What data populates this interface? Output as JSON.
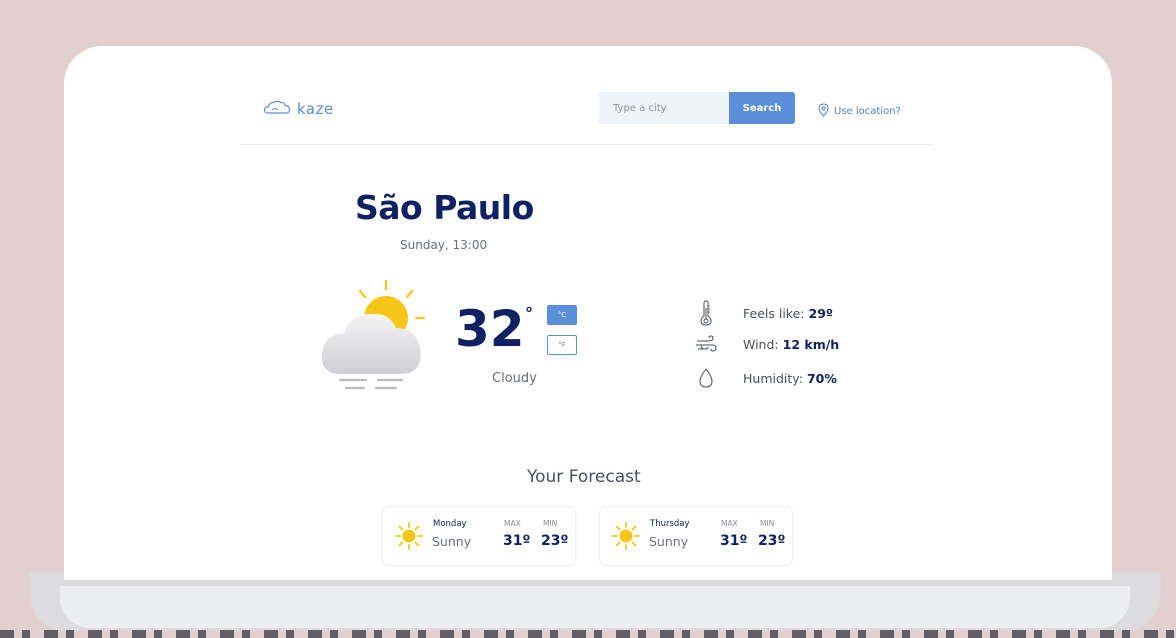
{
  "header": {
    "logo_text": "kaze",
    "search_placeholder": "Type a city",
    "search_label": "Search",
    "use_location_label": "Use location?"
  },
  "current": {
    "city": "São Paulo",
    "date": "Sunday, 13:00",
    "temperature": "32",
    "degree_symbol": "°",
    "unit_c": "°C",
    "unit_f": "°F",
    "selected_unit": "°C",
    "condition": "Cloudy",
    "condition_icon": "sun-behind-cloud-icon",
    "details": [
      {
        "icon": "thermometer-icon",
        "label": "Feels like:",
        "value": "29º"
      },
      {
        "icon": "wind-icon",
        "label": "Wind:",
        "value": "12 km/h"
      },
      {
        "icon": "humidity-drop-icon",
        "label": "Humidity:",
        "value": "70%"
      }
    ]
  },
  "forecast": {
    "title": "Your Forecast",
    "days": [
      {
        "day": "Monday",
        "condition": "Sunny",
        "icon": "sun-icon",
        "max_label": "MAX",
        "min_label": "MIN",
        "max": "31º",
        "min": "23º"
      },
      {
        "day": "Thursday",
        "condition": "Sunny",
        "icon": "sun-icon",
        "max_label": "MAX",
        "min_label": "MIN",
        "max": "31º",
        "min": "23º"
      }
    ]
  },
  "colors": {
    "background": "#e2d0d1",
    "accent": "#5b8fd7",
    "heading": "#0f2162",
    "sun": "#f5c518"
  }
}
